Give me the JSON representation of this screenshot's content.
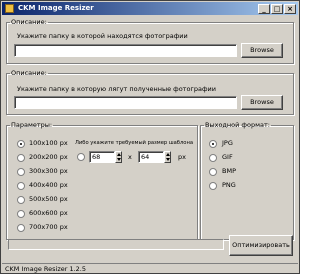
{
  "window": {
    "title": "CKM Image Resizer"
  },
  "titlebar_buttons": [
    "_",
    "□",
    "×"
  ],
  "source": {
    "legend": "Описание:",
    "label": "Укажите папку в которой находятся фотографии",
    "value": "",
    "browse": "Browse"
  },
  "dest": {
    "legend": "Описание:",
    "label": "Укажите папку в которую лягут полученные фотографии",
    "value": "",
    "browse": "Browse"
  },
  "params": {
    "legend": "Параметры:",
    "sizes": [
      "100x100 px",
      "200x200 px",
      "300x300 px",
      "400x400 px",
      "500x500 px",
      "600x600 px",
      "700x700 px"
    ],
    "selected": "100x100 px",
    "custom_label": "Либо укажите требуемый размер шаблона",
    "width": "68",
    "x_sep": "x",
    "height": "64",
    "unit": "px"
  },
  "format": {
    "legend": "Выходной формат:",
    "options": [
      "JPG",
      "GIF",
      "BMP",
      "PNG"
    ],
    "selected": "JPG"
  },
  "optimize_button": "Оптимизировать",
  "status": "CKM Image Resizer 1.2.5"
}
